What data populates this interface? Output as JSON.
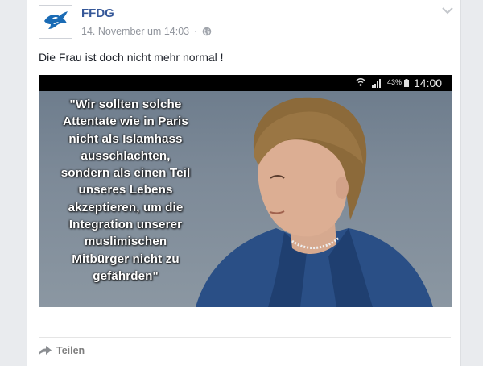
{
  "post": {
    "page_name": "FFDG",
    "timestamp": "14. November um 14:03",
    "separator": "·",
    "text": "Die Frau ist doch nicht mehr normal !"
  },
  "image": {
    "status_bar": {
      "battery_percent": "43%",
      "time": "14:00"
    },
    "quote": "\"Wir sollten solche\nAttentate wie in Paris\nnicht als Islamhass\nausschlachten,\nsondern als einen Teil\nunseres Lebens\nakzeptieren, um die\nIntegration unserer\nmuslimischen\nMitbürger nicht zu\ngefährden\""
  },
  "actions": {
    "share_label": "Teilen"
  },
  "colors": {
    "page_name": "#365899",
    "meta": "#90949c",
    "background": "#e9ebee"
  },
  "icons": [
    "dove-logo-icon",
    "globe-icon",
    "chevron-down-icon",
    "wifi-icon",
    "signal-icon",
    "battery-icon",
    "share-arrow-icon"
  ]
}
